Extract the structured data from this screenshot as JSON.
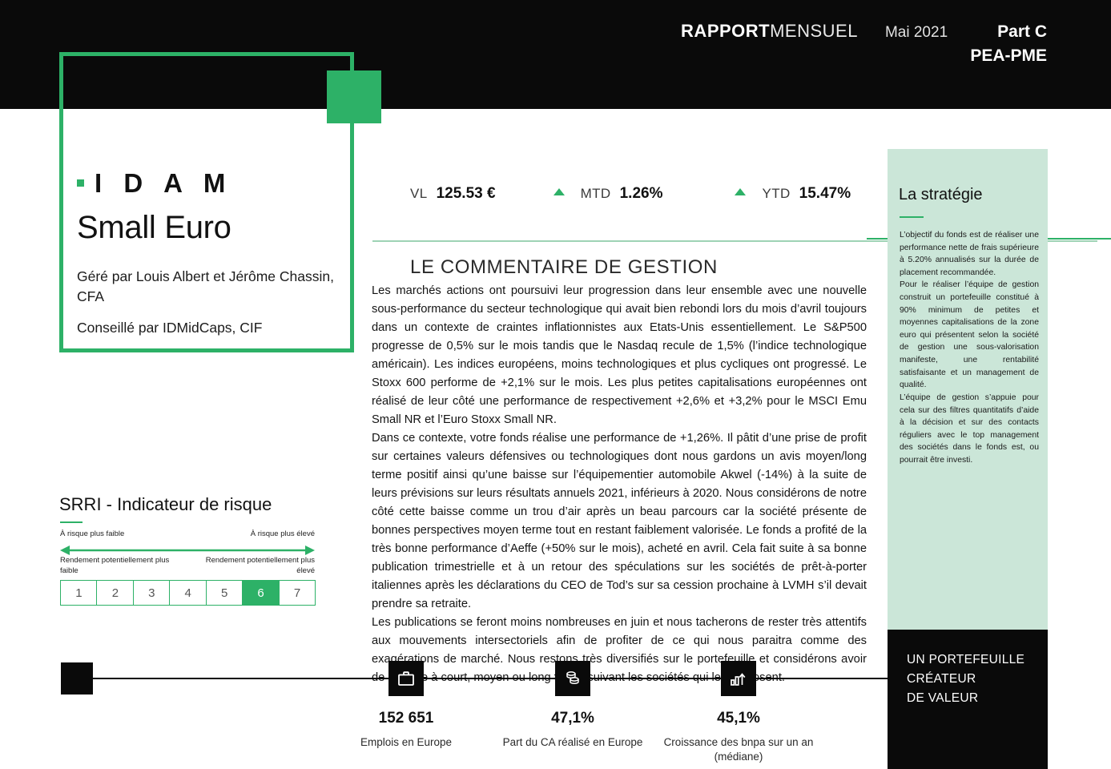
{
  "header": {
    "report_word_bold": "RAPPORT",
    "report_word_thin": "MENSUEL",
    "date": "Mai 2021",
    "share_class": "Part C",
    "wrapper": "PEA-PME"
  },
  "identity": {
    "logo_text": "I D A M",
    "fund_name": "Small Euro",
    "managed_by": "Géré par Louis Albert et Jérôme Chassin, CFA",
    "advised_by": "Conseillé par IDMidCaps, CIF"
  },
  "metrics": {
    "vl_label": "VL",
    "vl_value": "125.53 €",
    "mtd_label": "MTD",
    "mtd_value": "1.26%",
    "ytd_label": "YTD",
    "ytd_value": "15.47%"
  },
  "commentary": {
    "title": "LE COMMENTAIRE DE GESTION",
    "paragraphs": [
      "Les marchés actions ont poursuivi leur progression dans leur ensemble avec une nouvelle sous-performance du secteur technologique qui avait bien rebondi lors du mois d’avril toujours dans un contexte de craintes inflationnistes aux Etats-Unis essentiellement. Le S&P500 progresse de 0,5% sur le mois tandis que le Nasdaq recule de 1,5% (l’indice technologique américain). Les indices européens, moins technologiques et plus cycliques ont progressé. Le Stoxx 600 performe de +2,1% sur le mois. Les plus petites capitalisations européennes ont réalisé de leur côté une performance de respectivement +2,6% et +3,2% pour le MSCI Emu Small NR et l’Euro Stoxx Small NR.",
      "Dans ce contexte, votre fonds réalise une performance de +1,26%. Il pâtit d’une prise de profit sur certaines valeurs défensives ou technologiques dont nous gardons un avis moyen/long terme positif ainsi qu’une baisse sur l’équipementier automobile Akwel (-14%) à la suite de leurs prévisions sur leurs résultats annuels 2021, inférieurs à 2020. Nous considérons de notre côté cette baisse comme un trou d’air après un beau parcours car la société présente de bonnes perspectives moyen terme tout en restant faiblement valorisée. Le fonds a profité de la très bonne performance d’Aeffe (+50% sur le mois), acheté en avril. Cela fait suite à sa bonne publication trimestrielle et à un retour des spéculations sur les sociétés de prêt-à-porter italiennes après les déclarations du CEO de Tod’s sur sa cession prochaine à LVMH s’il devait prendre sa retraite.",
      "Les publications se feront moins nombreuses en juin et nous tacherons de rester très attentifs aux mouvements intersectoriels afin de profiter de ce qui nous paraitra comme des exagérations de marché. Nous restons très diversifiés sur le portefeuille et considérons avoir de l’upside à court, moyen ou long terme suivant les sociétés qui le composent."
    ]
  },
  "strategy": {
    "title": "La stratégie",
    "paragraphs": [
      "L’objectif du fonds est de réaliser une performance nette de frais supérieure à 5.20% annualisés sur la durée de placement recommandée.",
      "Pour le réaliser l’équipe de gestion construit un portefeuille constitué à 90% minimum de petites et moyennes capitalisations de la zone euro qui présentent selon la société de gestion une sous-valorisation manifeste, une rentabilité satisfaisante et un management de qualité.",
      "L’équipe de gestion s’appuie pour cela sur des filtres quantitatifs d’aide à la décision et sur des contacts réguliers avec le top management des sociétés dans le fonds est, ou pourrait être investi."
    ]
  },
  "value_panel": {
    "line1": "UN PORTEFEUILLE",
    "line2": "CRÉATEUR",
    "line3": "DE VALEUR"
  },
  "srri": {
    "title": "SRRI - Indicateur de risque",
    "caption_left": "À risque plus faible",
    "caption_right": "À risque plus élevé",
    "sub_left": "Rendement potentiellement plus faible",
    "sub_right": "Rendement potentiellement plus élevé",
    "levels": [
      "1",
      "2",
      "3",
      "4",
      "5",
      "6",
      "7"
    ],
    "active_level": "6"
  },
  "stats": [
    {
      "value": "152 651",
      "label": "Emplois en Europe",
      "icon": "briefcase-icon"
    },
    {
      "value": "47,1%",
      "label": "Part du CA réalisé en Europe",
      "icon": "coins-icon"
    },
    {
      "value": "45,1%",
      "label": "Croissance des bnpa sur un an (médiane)",
      "icon": "bar-chart-up-icon"
    }
  ],
  "colors": {
    "accent_green": "#2db167",
    "panel_mint": "#cbe6d8",
    "ink_black": "#0a0a0a"
  }
}
